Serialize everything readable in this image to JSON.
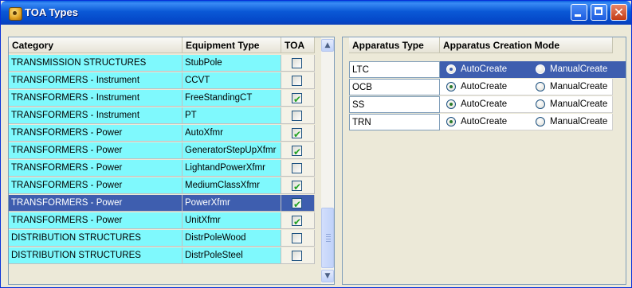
{
  "window": {
    "title": "TOA Types"
  },
  "left_table": {
    "headers": {
      "category": "Category",
      "equipment_type": "Equipment Type",
      "toa": "TOA"
    },
    "rows": [
      {
        "category": "TRANSMISSION STRUCTURES",
        "equipment_type": "StubPole",
        "toa": false,
        "selected": false
      },
      {
        "category": "TRANSFORMERS - Instrument",
        "equipment_type": "CCVT",
        "toa": false,
        "selected": false
      },
      {
        "category": "TRANSFORMERS - Instrument",
        "equipment_type": "FreeStandingCT",
        "toa": true,
        "selected": false
      },
      {
        "category": "TRANSFORMERS - Instrument",
        "equipment_type": "PT",
        "toa": false,
        "selected": false
      },
      {
        "category": "TRANSFORMERS - Power",
        "equipment_type": "AutoXfmr",
        "toa": true,
        "selected": false
      },
      {
        "category": "TRANSFORMERS - Power",
        "equipment_type": "GeneratorStepUpXfmr",
        "toa": true,
        "selected": false
      },
      {
        "category": "TRANSFORMERS - Power",
        "equipment_type": "LightandPowerXfmr",
        "toa": false,
        "selected": false
      },
      {
        "category": "TRANSFORMERS - Power",
        "equipment_type": "MediumClassXfmr",
        "toa": true,
        "selected": false
      },
      {
        "category": "TRANSFORMERS - Power",
        "equipment_type": "PowerXfmr",
        "toa": true,
        "selected": true
      },
      {
        "category": "TRANSFORMERS - Power",
        "equipment_type": "UnitXfmr",
        "toa": true,
        "selected": false
      },
      {
        "category": "DISTRIBUTION STRUCTURES",
        "equipment_type": "DistrPoleWood",
        "toa": false,
        "selected": false
      },
      {
        "category": "DISTRIBUTION STRUCTURES",
        "equipment_type": "DistrPoleSteel",
        "toa": false,
        "selected": false
      }
    ]
  },
  "right_table": {
    "headers": {
      "apparatus_type": "Apparatus Type",
      "creation_mode": "Apparatus Creation Mode"
    },
    "options": {
      "auto": "AutoCreate",
      "manual": "ManualCreate"
    },
    "rows": [
      {
        "type": "LTC",
        "mode": "AutoCreate",
        "selected": true
      },
      {
        "type": "OCB",
        "mode": "AutoCreate",
        "selected": false
      },
      {
        "type": "SS",
        "mode": "AutoCreate",
        "selected": false
      },
      {
        "type": "TRN",
        "mode": "AutoCreate",
        "selected": false
      }
    ]
  },
  "icons": {
    "app": "toa-app-icon",
    "minimize": "minimize-icon",
    "maximize": "maximize-icon",
    "close": "close-icon",
    "scroll_up": "scroll-up-arrow-icon",
    "scroll_down": "scroll-down-arrow-icon"
  }
}
